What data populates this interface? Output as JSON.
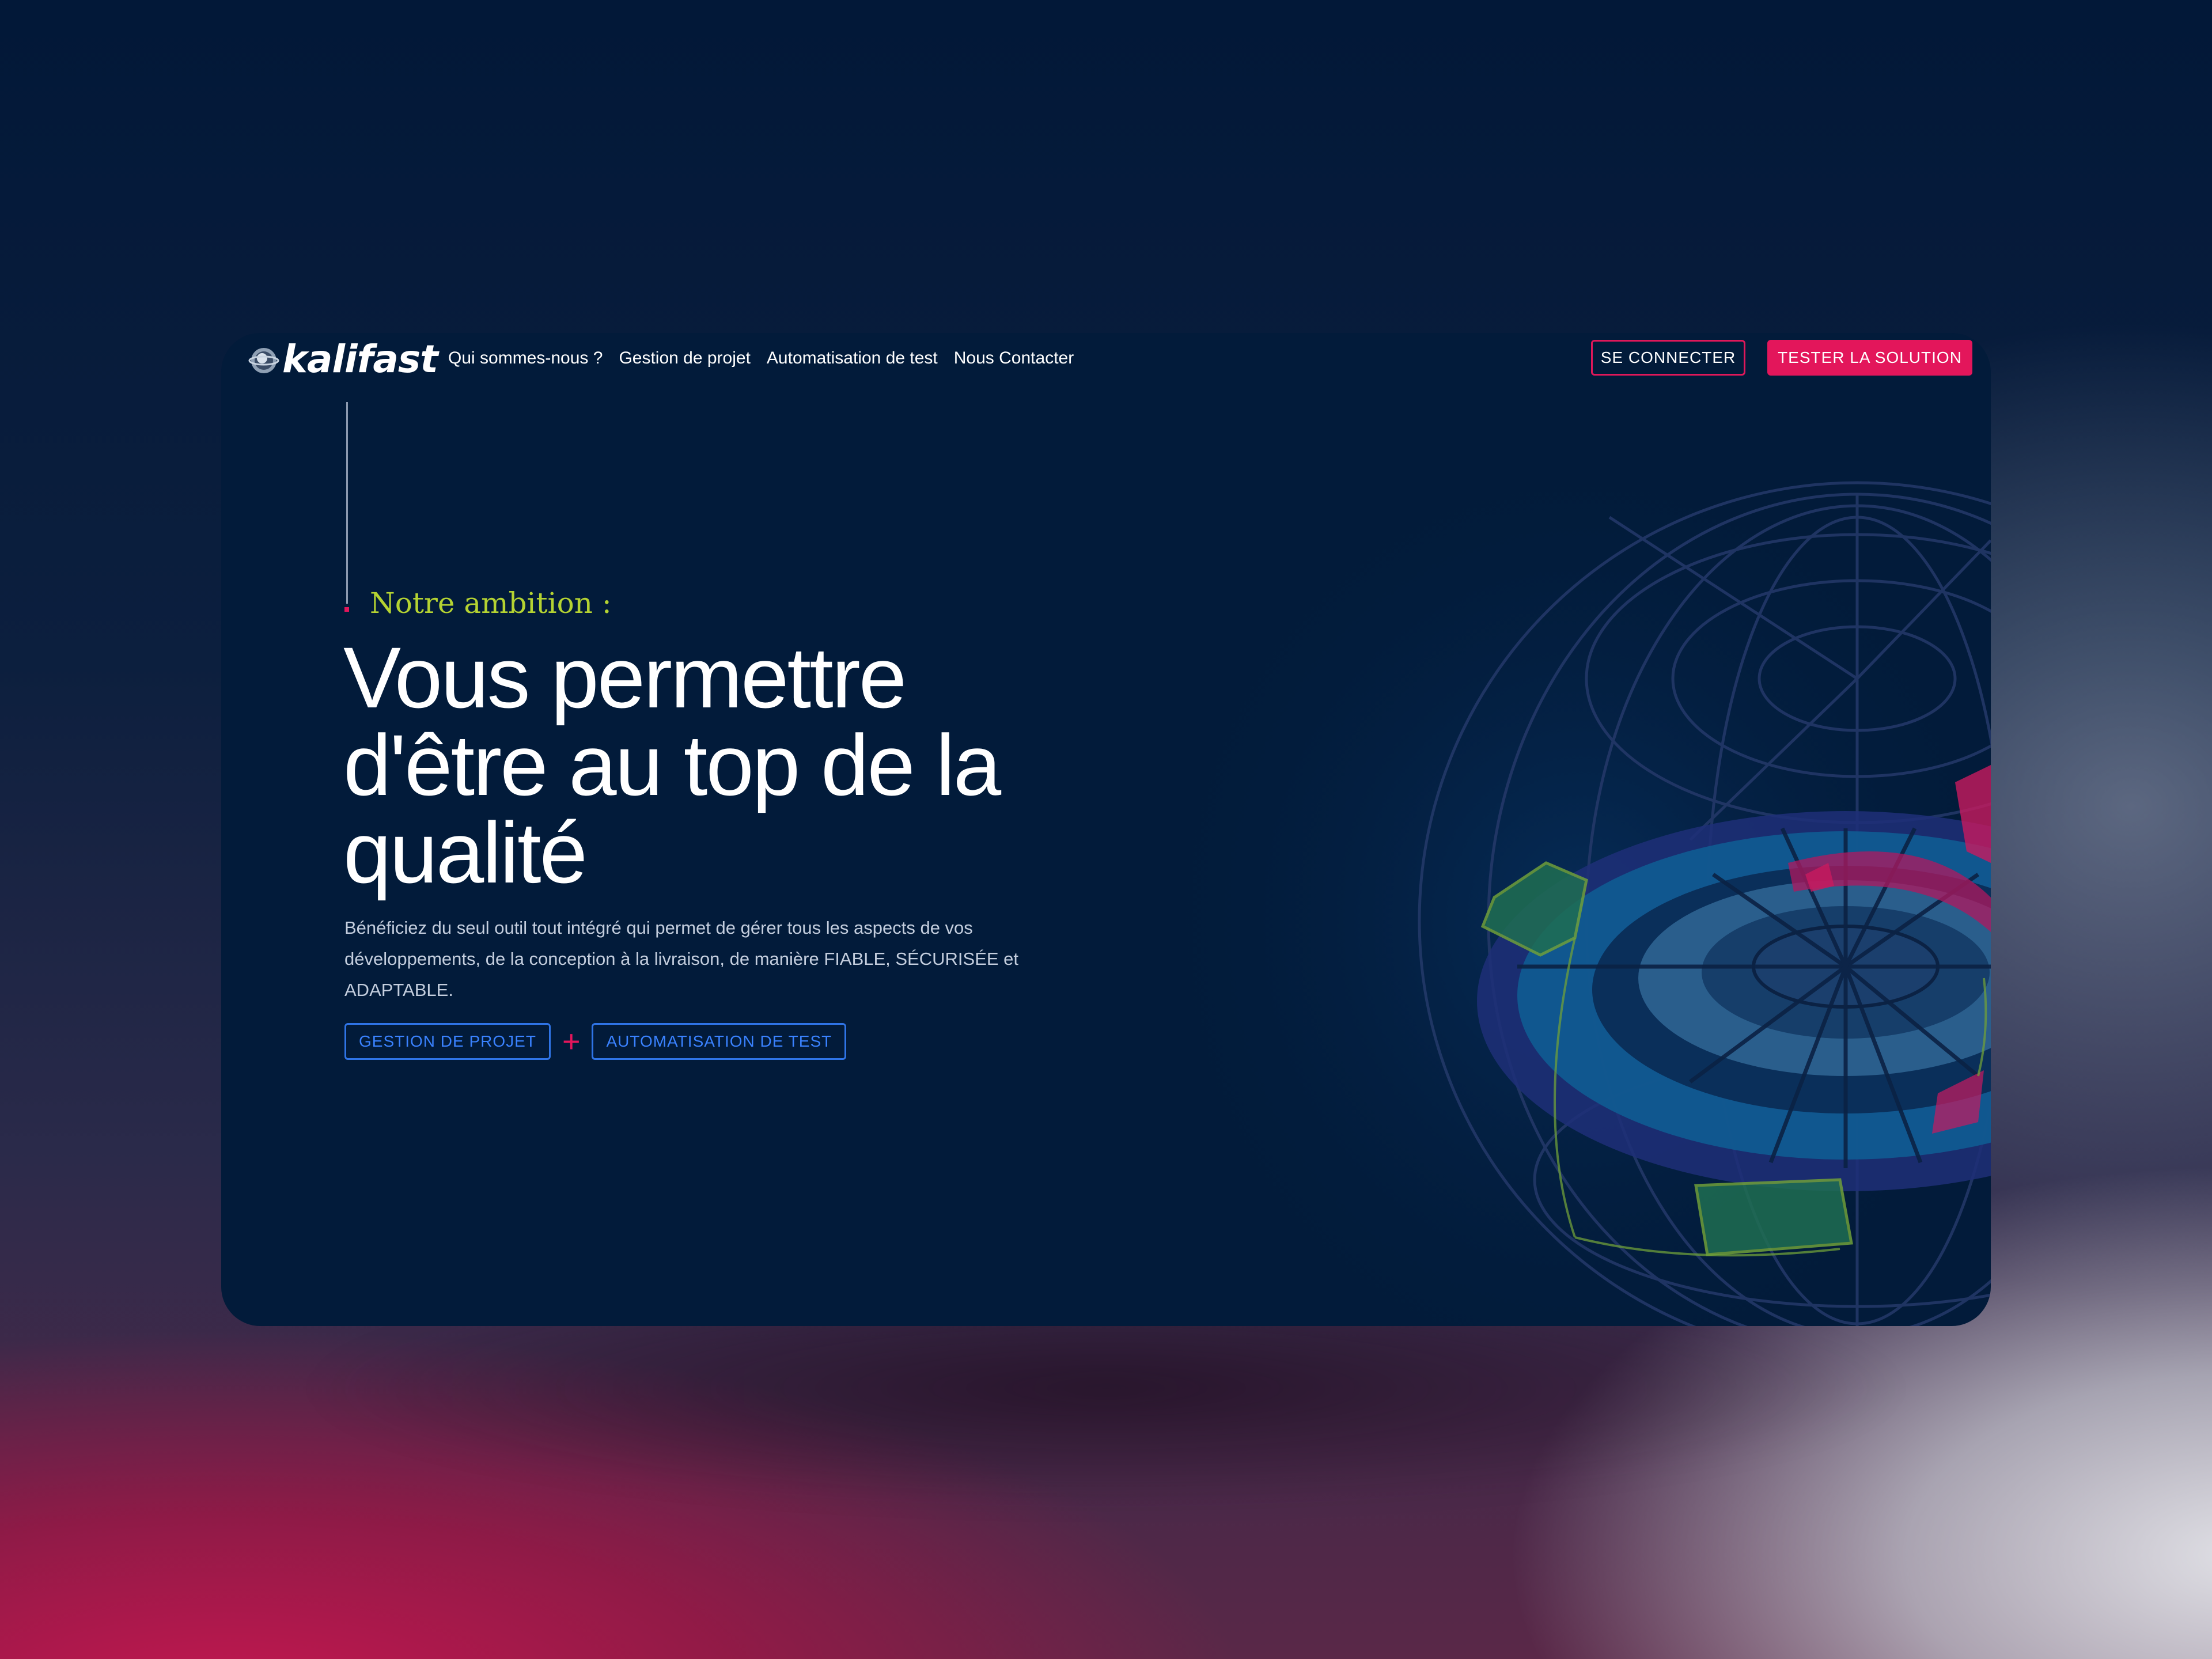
{
  "header": {
    "logo_text": "kalifast",
    "nav": [
      {
        "label": "Qui sommes-nous ?"
      },
      {
        "label": "Gestion de projet"
      },
      {
        "label": "Automatisation de test"
      },
      {
        "label": "Nous Contacter"
      }
    ],
    "login_label": "SE CONNECTER",
    "try_label": "TESTER LA SOLUTION"
  },
  "hero": {
    "eyebrow": "Notre ambition :",
    "headline": "Vous permettre d'être au top de la qualité",
    "description": "Bénéficiez du seul outil tout intégré qui permet de gérer tous les aspects de vos développements, de la conception à la livraison, de manière FIABLE, SÉCURISÉE et ADAPTABLE.",
    "cta_primary": "GESTION DE PROJET",
    "cta_plus": "+",
    "cta_secondary": "AUTOMATISATION DE TEST"
  },
  "colors": {
    "background": "#021b3a",
    "accent_pink": "#e3165b",
    "accent_lime": "#b5d332",
    "accent_blue": "#2f74e6"
  },
  "icons": {
    "logo": "kalifast-logo-icon",
    "illustration": "globe-wireframe-illustration"
  }
}
